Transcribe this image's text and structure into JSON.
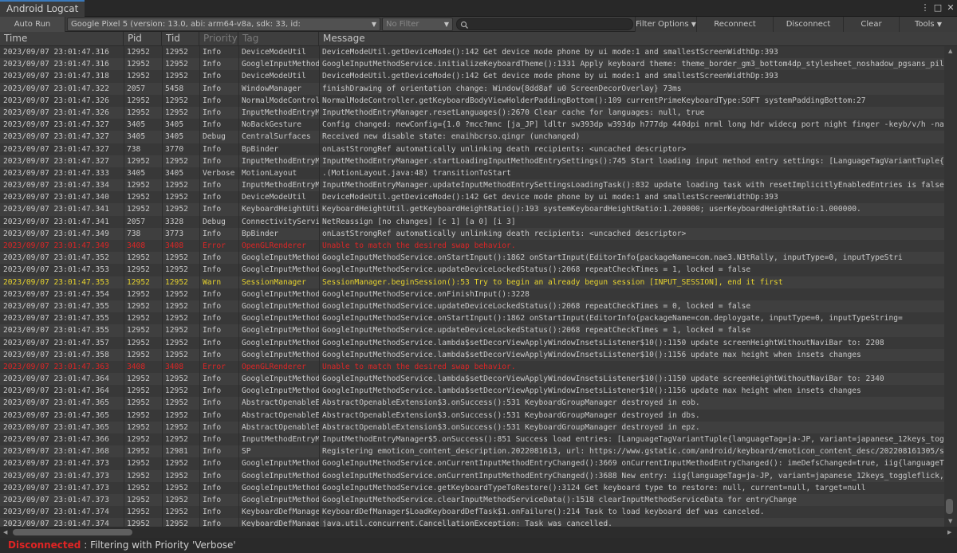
{
  "window": {
    "title": "Android Logcat"
  },
  "toolbar": {
    "auto_run_label": "Auto Run",
    "device_value": "Google Pixel 5 (version: 13.0, abi: arm64-v8a, sdk: 33, id:",
    "filter_value": "No Filter",
    "search_value": "",
    "filter_options_label": "Filter Options",
    "reconnect_label": "Reconnect",
    "disconnect_label": "Disconnect",
    "clear_label": "Clear",
    "tools_label": "Tools"
  },
  "columns": {
    "time": "Time",
    "pid": "Pid",
    "tid": "Tid",
    "priority": "Priority",
    "tag": "Tag",
    "message": "Message"
  },
  "rows": [
    {
      "time": "2023/09/07 23:01:47.316",
      "pid": "12952",
      "tid": "12952",
      "priority": "Info",
      "tag": "DeviceModeUtil",
      "message": "DeviceModeUtil.getDeviceMode():142 Get device mode phone by ui mode:1 and smallestScreenWidthDp:393",
      "level": "info"
    },
    {
      "time": "2023/09/07 23:01:47.316",
      "pid": "12952",
      "tid": "12952",
      "priority": "Info",
      "tag": "GoogleInputMethod",
      "message": "GoogleInputMethodService.initializeKeyboardTheme():1331 Apply keyboard theme: theme_border_gm3_bottom4dp_stylesheet_noshadow_pgsans_pillK",
      "level": "info"
    },
    {
      "time": "2023/09/07 23:01:47.318",
      "pid": "12952",
      "tid": "12952",
      "priority": "Info",
      "tag": "DeviceModeUtil",
      "message": "DeviceModeUtil.getDeviceMode():142 Get device mode phone by ui mode:1 and smallestScreenWidthDp:393",
      "level": "info"
    },
    {
      "time": "2023/09/07 23:01:47.322",
      "pid": "2057",
      "tid": "5458",
      "priority": "Info",
      "tag": "WindowManager",
      "message": "finishDrawing of orientation change: Window{8dd8af u0 ScreenDecorOverlay} 73ms",
      "level": "info"
    },
    {
      "time": "2023/09/07 23:01:47.326",
      "pid": "12952",
      "tid": "12952",
      "priority": "Info",
      "tag": "NormalModeControl",
      "message": "NormalModeController.getKeyboardBodyViewHolderPaddingBottom():109 currentPrimeKeyboardType:SOFT systemPaddingBottom:27",
      "level": "info"
    },
    {
      "time": "2023/09/07 23:01:47.326",
      "pid": "12952",
      "tid": "12952",
      "priority": "Info",
      "tag": "InputMethodEntryM",
      "message": "InputMethodEntryManager.resetLanguages():2670 Clear cache for languages: null, true",
      "level": "info"
    },
    {
      "time": "2023/09/07 23:01:47.327",
      "pid": "3405",
      "tid": "3405",
      "priority": "Info",
      "tag": "NoBackGesture",
      "message": "Config changed: newConfig={1.0 ?mcc?mnc [ja_JP] ldltr sw393dp w393dp h777dp 440dpi nrml long hdr widecg port night finger -keyb/v/h -nav/",
      "level": "info"
    },
    {
      "time": "2023/09/07 23:01:47.327",
      "pid": "3405",
      "tid": "3405",
      "priority": "Debug",
      "tag": "CentralSurfaces",
      "message": "Received new disable state: enaihbcrso.qingr (unchanged)",
      "level": "info"
    },
    {
      "time": "2023/09/07 23:01:47.327",
      "pid": "738",
      "tid": "3770",
      "priority": "Info",
      "tag": "BpBinder",
      "message": "onLastStrongRef automatically unlinking death recipients: <uncached descriptor>",
      "level": "info"
    },
    {
      "time": "2023/09/07 23:01:47.327",
      "pid": "12952",
      "tid": "12952",
      "priority": "Info",
      "tag": "InputMethodEntryM",
      "message": "InputMethodEntryManager.startLoadingInputMethodEntrySettings():745 Start loading input method entry settings: [LanguageTagVariantTuple{la",
      "level": "info"
    },
    {
      "time": "2023/09/07 23:01:47.333",
      "pid": "3405",
      "tid": "3405",
      "priority": "Verbose",
      "tag": "MotionLayout",
      "message": ".(MotionLayout.java:48) transitionToStart",
      "level": "info"
    },
    {
      "time": "2023/09/07 23:01:47.334",
      "pid": "12952",
      "tid": "12952",
      "priority": "Info",
      "tag": "InputMethodEntryM",
      "message": "InputMethodEntryManager.updateInputMethodEntrySettingsLoadingTask():832 update loading task with resetImplicitlyEnabledEntries is false",
      "level": "info"
    },
    {
      "time": "2023/09/07 23:01:47.340",
      "pid": "12952",
      "tid": "12952",
      "priority": "Info",
      "tag": "DeviceModeUtil",
      "message": "DeviceModeUtil.getDeviceMode():142 Get device mode phone by ui mode:1 and smallestScreenWidthDp:393",
      "level": "info"
    },
    {
      "time": "2023/09/07 23:01:47.341",
      "pid": "12952",
      "tid": "12952",
      "priority": "Info",
      "tag": "KeyboardHeightUti",
      "message": "KeyboardHeightUtil.getKeyboardHeightRatio():193 systemKeyboardHeightRatio:1.200000; userKeyboardHeightRatio:1.000000.",
      "level": "info"
    },
    {
      "time": "2023/09/07 23:01:47.341",
      "pid": "2057",
      "tid": "3328",
      "priority": "Debug",
      "tag": "ConnectivityServi",
      "message": "NetReassign [no changes] [c 1] [a 0] [i 3]",
      "level": "info"
    },
    {
      "time": "2023/09/07 23:01:47.349",
      "pid": "738",
      "tid": "3773",
      "priority": "Info",
      "tag": "BpBinder",
      "message": "onLastStrongRef automatically unlinking death recipients: <uncached descriptor>",
      "level": "info"
    },
    {
      "time": "2023/09/07 23:01:47.349",
      "pid": "3408",
      "tid": "3408",
      "priority": "Error",
      "tag": "OpenGLRenderer",
      "message": "Unable to match the desired swap behavior.",
      "level": "error"
    },
    {
      "time": "2023/09/07 23:01:47.352",
      "pid": "12952",
      "tid": "12952",
      "priority": "Info",
      "tag": "GoogleInputMethod",
      "message": "GoogleInputMethodService.onStartInput():1862 onStartInput(EditorInfo{packageName=com.nae3.N3tRally, inputType=0, inputTypeStri",
      "level": "info"
    },
    {
      "time": "2023/09/07 23:01:47.353",
      "pid": "12952",
      "tid": "12952",
      "priority": "Info",
      "tag": "GoogleInputMethod",
      "message": "GoogleInputMethodService.updateDeviceLockedStatus():2068 repeatCheckTimes = 1, locked = false",
      "level": "info"
    },
    {
      "time": "2023/09/07 23:01:47.353",
      "pid": "12952",
      "tid": "12952",
      "priority": "Warn",
      "tag": "SessionManager",
      "message": "SessionManager.beginSession():53 Try to begin an already begun session [INPUT_SESSION], end it first",
      "level": "warn"
    },
    {
      "time": "2023/09/07 23:01:47.354",
      "pid": "12952",
      "tid": "12952",
      "priority": "Info",
      "tag": "GoogleInputMethod",
      "message": "GoogleInputMethodService.onFinishInput():3228",
      "level": "info"
    },
    {
      "time": "2023/09/07 23:01:47.355",
      "pid": "12952",
      "tid": "12952",
      "priority": "Info",
      "tag": "GoogleInputMethod",
      "message": "GoogleInputMethodService.updateDeviceLockedStatus():2068 repeatCheckTimes = 0, locked = false",
      "level": "info"
    },
    {
      "time": "2023/09/07 23:01:47.355",
      "pid": "12952",
      "tid": "12952",
      "priority": "Info",
      "tag": "GoogleInputMethod",
      "message": "GoogleInputMethodService.onStartInput():1862 onStartInput(EditorInfo{packageName=com.deploygate, inputType=0, inputTypeString=",
      "level": "info"
    },
    {
      "time": "2023/09/07 23:01:47.355",
      "pid": "12952",
      "tid": "12952",
      "priority": "Info",
      "tag": "GoogleInputMethod",
      "message": "GoogleInputMethodService.updateDeviceLockedStatus():2068 repeatCheckTimes = 1, locked = false",
      "level": "info"
    },
    {
      "time": "2023/09/07 23:01:47.357",
      "pid": "12952",
      "tid": "12952",
      "priority": "Info",
      "tag": "GoogleInputMethod",
      "message": "GoogleInputMethodService.lambda$setDecorViewApplyWindowInsetsListener$10():1150 update screenHeightWithoutNaviBar to: 2208",
      "level": "info"
    },
    {
      "time": "2023/09/07 23:01:47.358",
      "pid": "12952",
      "tid": "12952",
      "priority": "Info",
      "tag": "GoogleInputMethod",
      "message": "GoogleInputMethodService.lambda$setDecorViewApplyWindowInsetsListener$10():1156 update max height when insets changes",
      "level": "info"
    },
    {
      "time": "2023/09/07 23:01:47.363",
      "pid": "3408",
      "tid": "3408",
      "priority": "Error",
      "tag": "OpenGLRenderer",
      "message": "Unable to match the desired swap behavior.",
      "level": "error"
    },
    {
      "time": "2023/09/07 23:01:47.364",
      "pid": "12952",
      "tid": "12952",
      "priority": "Info",
      "tag": "GoogleInputMethod",
      "message": "GoogleInputMethodService.lambda$setDecorViewApplyWindowInsetsListener$10():1150 update screenHeightWithoutNaviBar to: 2340",
      "level": "info"
    },
    {
      "time": "2023/09/07 23:01:47.364",
      "pid": "12952",
      "tid": "12952",
      "priority": "Info",
      "tag": "GoogleInputMethod",
      "message": "GoogleInputMethodService.lambda$setDecorViewApplyWindowInsetsListener$10():1156 update max height when insets changes",
      "level": "info"
    },
    {
      "time": "2023/09/07 23:01:47.365",
      "pid": "12952",
      "tid": "12952",
      "priority": "Info",
      "tag": "AbstractOpenableE",
      "message": "AbstractOpenableExtension$3.onSuccess():531 KeyboardGroupManager destroyed in eob.",
      "level": "info"
    },
    {
      "time": "2023/09/07 23:01:47.365",
      "pid": "12952",
      "tid": "12952",
      "priority": "Info",
      "tag": "AbstractOpenableE",
      "message": "AbstractOpenableExtension$3.onSuccess():531 KeyboardGroupManager destroyed in dbs.",
      "level": "info"
    },
    {
      "time": "2023/09/07 23:01:47.365",
      "pid": "12952",
      "tid": "12952",
      "priority": "Info",
      "tag": "AbstractOpenableE",
      "message": "AbstractOpenableExtension$3.onSuccess():531 KeyboardGroupManager destroyed in epz.",
      "level": "info"
    },
    {
      "time": "2023/09/07 23:01:47.366",
      "pid": "12952",
      "tid": "12952",
      "priority": "Info",
      "tag": "InputMethodEntryM",
      "message": "InputMethodEntryManager$5.onSuccess():851 Success load entries: [LanguageTagVariantTuple{languageTag=ja-JP, variant=japanese_12keys_toggl",
      "level": "info"
    },
    {
      "time": "2023/09/07 23:01:47.368",
      "pid": "12952",
      "tid": "12981",
      "priority": "Info",
      "tag": "SP",
      "message": "Registering emoticon_content_description.2022081613, url: https://www.gstatic.com/android/keyboard/emoticon_content_desc/202208161305/su",
      "level": "info"
    },
    {
      "time": "2023/09/07 23:01:47.373",
      "pid": "12952",
      "tid": "12952",
      "priority": "Info",
      "tag": "GoogleInputMethod",
      "message": "GoogleInputMethodService.onCurrentInputMethodEntryChanged():3669 onCurrentInputMethodEntryChanged(): imeDefsChanged=true, iig{languageTa",
      "level": "info"
    },
    {
      "time": "2023/09/07 23:01:47.373",
      "pid": "12952",
      "tid": "12952",
      "priority": "Info",
      "tag": "GoogleInputMethod",
      "message": "GoogleInputMethodService.onCurrentInputMethodEntryChanged():3688 New entry: iig{languageTag=ja-JP, variant=japanese_12keys_toggleflick, h",
      "level": "info"
    },
    {
      "time": "2023/09/07 23:01:47.373",
      "pid": "12952",
      "tid": "12952",
      "priority": "Info",
      "tag": "GoogleInputMethod",
      "message": "GoogleInputMethodService.getKeyboardTypeToRestore():3124 Get keyboard type to restore: null, current=null, target=null",
      "level": "info"
    },
    {
      "time": "2023/09/07 23:01:47.373",
      "pid": "12952",
      "tid": "12952",
      "priority": "Info",
      "tag": "GoogleInputMethod",
      "message": "GoogleInputMethodService.clearInputMethodServiceData():1518 clearInputMethodServiceData for entryChange",
      "level": "info"
    },
    {
      "time": "2023/09/07 23:01:47.374",
      "pid": "12952",
      "tid": "12952",
      "priority": "Info",
      "tag": "KeyboardDefManage",
      "message": "KeyboardDefManager$LoadKeyboardDefTask$1.onFailure():214 Task to load keyboard def was canceled.",
      "level": "info"
    },
    {
      "time": "2023/09/07 23:01:47.374",
      "pid": "12952",
      "tid": "12952",
      "priority": "Info",
      "tag": "KeyboardDefManage",
      "message": "java.util.concurrent.CancellationException: Task was cancelled.",
      "level": "info"
    }
  ],
  "status": {
    "state": "Disconnected",
    "text": " : Filtering with Priority 'Verbose'"
  },
  "colors": {
    "accent": "#3a79bb",
    "error": "#dc2626",
    "warn": "#e6d22e",
    "disconnected": "#e02424"
  }
}
